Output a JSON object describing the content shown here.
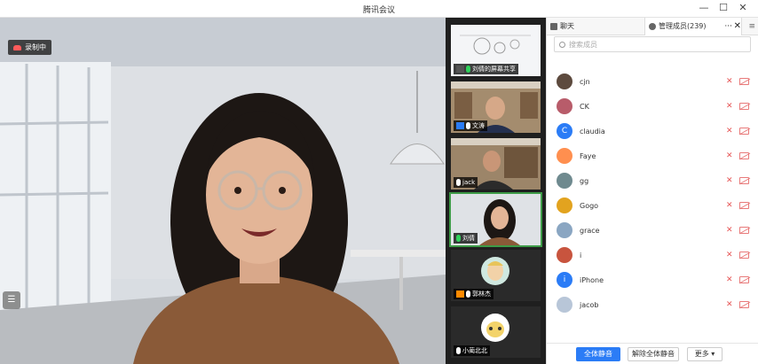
{
  "window": {
    "title": "腾讯会议",
    "minimize": "—",
    "maximize": "☐",
    "close": "✕"
  },
  "main_video": {
    "recording_label": "录制中",
    "speaker_name": "刘倩",
    "list_icon": "list-icon"
  },
  "thumbnails": [
    {
      "label": "刘倩的屏幕共享",
      "icon": "screen-share-icon"
    },
    {
      "label": "文涛",
      "icon": "user-icon"
    },
    {
      "label": "jack",
      "icon": "mic-icon"
    },
    {
      "label": "刘倩",
      "icon": "mic-icon",
      "active": true
    },
    {
      "label": "郭林杰",
      "icon": "user-icon"
    },
    {
      "label": "小蔺北北",
      "icon": "mic-icon"
    }
  ],
  "panel": {
    "tab_chat": "聊天",
    "tab_members": "管理成员(239)",
    "more": "···",
    "close": "✕",
    "menu": "≡",
    "search_placeholder": "搜索成员",
    "members": [
      {
        "name": "cjn",
        "avatar_color": "#5d4a3e"
      },
      {
        "name": "CK",
        "avatar_color": "#b85c6a"
      },
      {
        "name": "claudia",
        "avatar_color": "#2b7cf6",
        "initial": "C"
      },
      {
        "name": "Faye",
        "avatar_color": "#ff8f4f"
      },
      {
        "name": "gg",
        "avatar_color": "#6f8a8f"
      },
      {
        "name": "Gogo",
        "avatar_color": "#e2a31f"
      },
      {
        "name": "grace",
        "avatar_color": "#8aa6c2"
      },
      {
        "name": "i",
        "avatar_color": "#c8543e"
      },
      {
        "name": "iPhone",
        "avatar_color": "#2b7cf6",
        "initial": "i"
      },
      {
        "name": "jacob",
        "avatar_color": "#b8c6d8"
      }
    ],
    "btn_mute_all": "全体静音",
    "btn_unmute_all": "解除全体静音",
    "btn_more": "更多 ▾"
  }
}
